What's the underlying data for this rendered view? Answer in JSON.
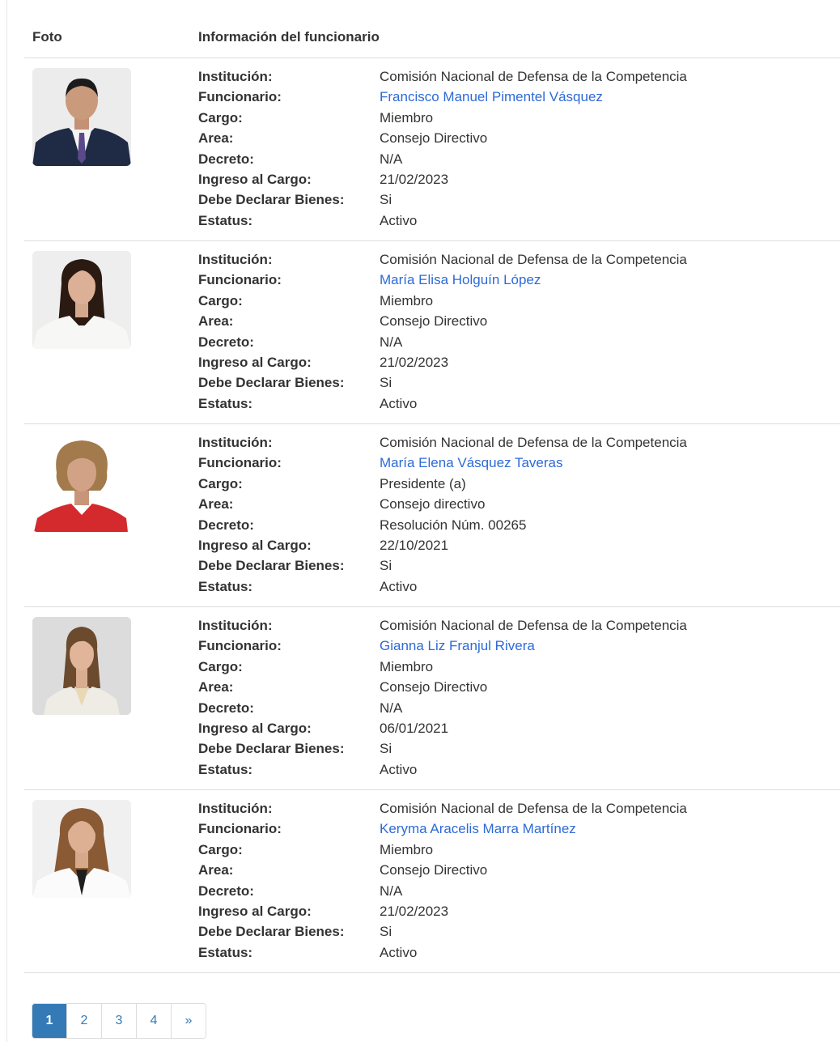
{
  "table": {
    "headers": {
      "photo": "Foto",
      "info": "Información del funcionario"
    },
    "labels": {
      "institucion": "Institución:",
      "funcionario": "Funcionario:",
      "cargo": "Cargo:",
      "area": "Area:",
      "decreto": "Decreto:",
      "ingreso": "Ingreso al Cargo:",
      "declara": "Debe Declarar Bienes:",
      "estatus": "Estatus:"
    },
    "rows": [
      {
        "institucion": "Comisión Nacional de Defensa de la Competencia",
        "funcionario": "Francisco Manuel Pimentel Vásquez",
        "cargo": "Miembro",
        "area": "Consejo Directivo",
        "decreto": "N/A",
        "ingreso": "21/02/2023",
        "declara": "Si",
        "estatus": "Activo"
      },
      {
        "institucion": "Comisión Nacional de Defensa de la Competencia",
        "funcionario": "María Elisa Holguín López",
        "cargo": "Miembro",
        "area": "Consejo Directivo",
        "decreto": "N/A",
        "ingreso": "21/02/2023",
        "declara": "Si",
        "estatus": "Activo"
      },
      {
        "institucion": "Comisión Nacional de Defensa de la Competencia",
        "funcionario": "María Elena Vásquez Taveras",
        "cargo": "Presidente (a)",
        "area": "Consejo directivo",
        "decreto": "Resolución Núm. 00265",
        "ingreso": "22/10/2021",
        "declara": "Si",
        "estatus": "Activo"
      },
      {
        "institucion": "Comisión Nacional de Defensa de la Competencia",
        "funcionario": "Gianna Liz Franjul Rivera",
        "cargo": "Miembro",
        "area": "Consejo Directivo",
        "decreto": "N/A",
        "ingreso": "06/01/2021",
        "declara": "Si",
        "estatus": "Activo"
      },
      {
        "institucion": "Comisión Nacional de Defensa de la Competencia",
        "funcionario": "Keryma Aracelis Marra Martínez",
        "cargo": "Miembro",
        "area": "Consejo Directivo",
        "decreto": "N/A",
        "ingreso": "21/02/2023",
        "declara": "Si",
        "estatus": "Activo"
      }
    ]
  },
  "pagination": {
    "pages": [
      "1",
      "2",
      "3",
      "4",
      "»"
    ],
    "active": "1"
  },
  "colors": {
    "link": "#2d6ad8",
    "active_page": "#337ab7",
    "border": "#dddddd"
  }
}
